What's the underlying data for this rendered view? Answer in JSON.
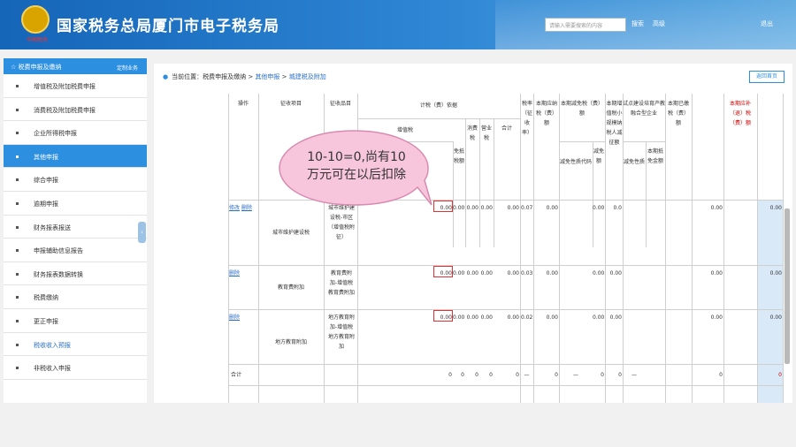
{
  "header": {
    "title": "国家税务总局厦门市电子税务局",
    "emblem_text": "中国税务",
    "search_placeholder": "请输入需要搜索的内容",
    "search_button": "搜索",
    "search_extra": "高级",
    "logout": "退出"
  },
  "sidebar": {
    "title": "税费申报及缴纳",
    "customize": "定制业务",
    "items": [
      {
        "label": "增值税及附加税费申报"
      },
      {
        "label": "消费税及附加税费申报"
      },
      {
        "label": "企业所得税申报"
      },
      {
        "label": "其他申报"
      },
      {
        "label": "综合申报"
      },
      {
        "label": "逾期申报"
      },
      {
        "label": "财务报表报送"
      },
      {
        "label": "申报辅助信息报告"
      },
      {
        "label": "财务报表数据转换"
      },
      {
        "label": "税费缴纳"
      },
      {
        "label": "更正申报"
      },
      {
        "label": "税收收入预报"
      },
      {
        "label": "非税收入申报"
      }
    ]
  },
  "breadcrumb": {
    "prefix": "当前位置：",
    "root": "税费申报及缴纳",
    "sep1": " > ",
    "level2": "其他申报",
    "sep2": " > ",
    "level3": "城建税及附加"
  },
  "back_home": "返回首页",
  "table": {
    "headers": {
      "op": "操作",
      "item": "征收项目",
      "subitem": "征收品目",
      "basis": "计税（费）依据",
      "vat": "增值税",
      "consumption": "消费税",
      "business": "营业税",
      "total": "合计",
      "exempt": "免抵税额",
      "rate": "税率（征收率）",
      "payable": "本期应纳税（费）额",
      "relief": "本期减免税（费）额",
      "relief_code": "减免性质代码",
      "relief_amt": "减免额",
      "small": "本期增值税小规模纳税人减征额",
      "pilot": "试点建设培育产教融合型企业",
      "pilot_code": "减免性质",
      "pilot_amt": "本期抵免金额",
      "paid": "本期已缴税（费）额",
      "due": "本期应补（退）税（费）额"
    },
    "rows": [
      {
        "ops": [
          "修改",
          "删除"
        ],
        "item": "城市维护建设税",
        "subitem": "城市维护建设税-市区（增值税附征）",
        "vat": "0.00",
        "exempt": "0.00",
        "consumption": "0.00",
        "business": "0.00",
        "total": "0.00",
        "rate": "0.07",
        "payable": "0.00",
        "relief_amt": "0.00",
        "small": "0.0",
        "paid": "0.00",
        "due": "0.00"
      },
      {
        "ops": [
          "删除"
        ],
        "item": "教育费附加",
        "subitem": "教育费附加-增值税教育费附加",
        "vat": "0.00",
        "exempt": "0.00",
        "consumption": "0.00",
        "business": "0.00",
        "total": "0.00",
        "rate": "0.03",
        "payable": "0.00",
        "relief_amt": "0.00",
        "small": "0.00",
        "paid": "0.00",
        "due": "0.00"
      },
      {
        "ops": [
          "删除"
        ],
        "item": "地方教育附加",
        "subitem": "地方教育附加-增值税地方教育附加",
        "vat": "0.00",
        "exempt": "0.00",
        "consumption": "0.00",
        "business": "0.00",
        "total": "0.00",
        "rate": "0.02",
        "payable": "0.00",
        "relief_amt": "0.00",
        "small": "0.00",
        "paid": "0.00",
        "due": "0.00"
      }
    ],
    "total_row": {
      "label": "合计",
      "vat": "0",
      "exempt": "0",
      "consumption": "0",
      "business": "0",
      "total": "0",
      "rate": "—",
      "payable": "0",
      "relief_code": "—",
      "relief_amt": "0",
      "small": "0",
      "pilot_code": "—",
      "paid": "0",
      "due": "0"
    }
  },
  "callout": {
    "line1": "10-10=0,尚有10",
    "line2": "万元可在以后扣除"
  },
  "colors": {
    "header": "#1565b8",
    "accent": "#2d8fdf",
    "highlight_box": "#d33",
    "callout": "#f7c6dc",
    "due_text": "#c00"
  }
}
